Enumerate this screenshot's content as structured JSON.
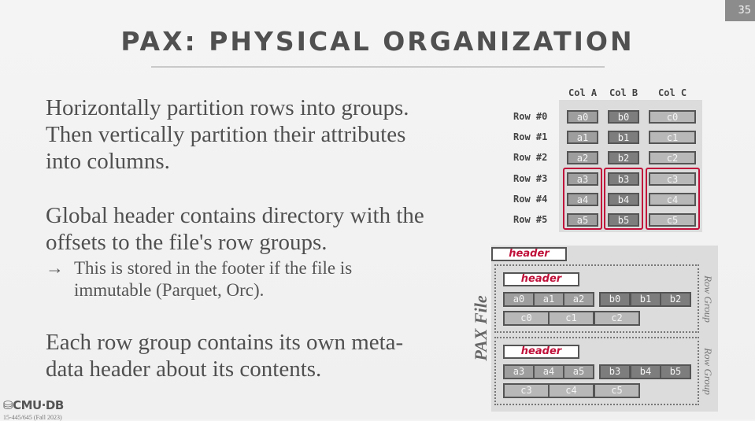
{
  "slide": {
    "page_number": "35",
    "title": "PAX: PHYSICAL ORGANIZATION",
    "paragraphs": [
      "Horizontally partition rows into groups. Then vertically partition their attributes into columns.",
      "Global header contains directory with the offsets to the file's row groups.",
      "Each row group contains its own meta-data header about its contents."
    ],
    "sub_bullet": {
      "arrow": "→",
      "text": "This is stored in the footer if the file is immutable (Parquet, Orc)."
    },
    "footer": {
      "logo": "CMU·DB",
      "course": "15-445/645 (Fall 2023)"
    }
  },
  "table_diagram": {
    "columns": [
      "Col A",
      "Col B",
      "Col C"
    ],
    "rows": [
      {
        "label": "Row #0",
        "cells": [
          "a0",
          "b0",
          "c0"
        ]
      },
      {
        "label": "Row #1",
        "cells": [
          "a1",
          "b1",
          "c1"
        ]
      },
      {
        "label": "Row #2",
        "cells": [
          "a2",
          "b2",
          "c2"
        ]
      },
      {
        "label": "Row #3",
        "cells": [
          "a3",
          "b3",
          "c3"
        ]
      },
      {
        "label": "Row #4",
        "cells": [
          "a4",
          "b4",
          "c4"
        ]
      },
      {
        "label": "Row #5",
        "cells": [
          "a5",
          "b5",
          "c5"
        ]
      }
    ],
    "highlight_color": "#c0113a"
  },
  "pax_file": {
    "label": "PAX File",
    "global_header": "header",
    "row_groups": [
      {
        "label": "Row Group",
        "header": "header",
        "col_a": [
          "a0",
          "a1",
          "a2"
        ],
        "col_b": [
          "b0",
          "b1",
          "b2"
        ],
        "col_c": [
          "c0",
          "c1",
          "c2"
        ]
      },
      {
        "label": "Row Group",
        "header": "header",
        "col_a": [
          "a3",
          "a4",
          "a5"
        ],
        "col_b": [
          "b3",
          "b4",
          "b5"
        ],
        "col_c": [
          "c3",
          "c4",
          "c5"
        ]
      }
    ]
  }
}
